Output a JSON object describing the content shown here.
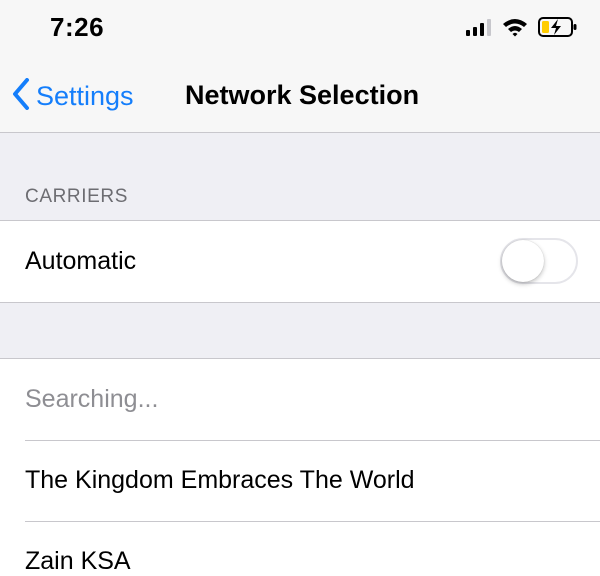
{
  "status_bar": {
    "time": "7:26",
    "icons": [
      "cellular-signal-icon",
      "wifi-icon",
      "battery-charging-icon"
    ]
  },
  "nav": {
    "back_label": "Settings",
    "title": "Network Selection",
    "accent_color": "#147efb"
  },
  "carriers_section": {
    "header": "CARRIERS",
    "automatic_label": "Automatic",
    "automatic_enabled": false
  },
  "network_list": {
    "items": [
      {
        "label": "Searching...",
        "muted": true
      },
      {
        "label": "The Kingdom Embraces The World",
        "muted": false
      },
      {
        "label": "Zain KSA",
        "muted": false
      }
    ]
  }
}
